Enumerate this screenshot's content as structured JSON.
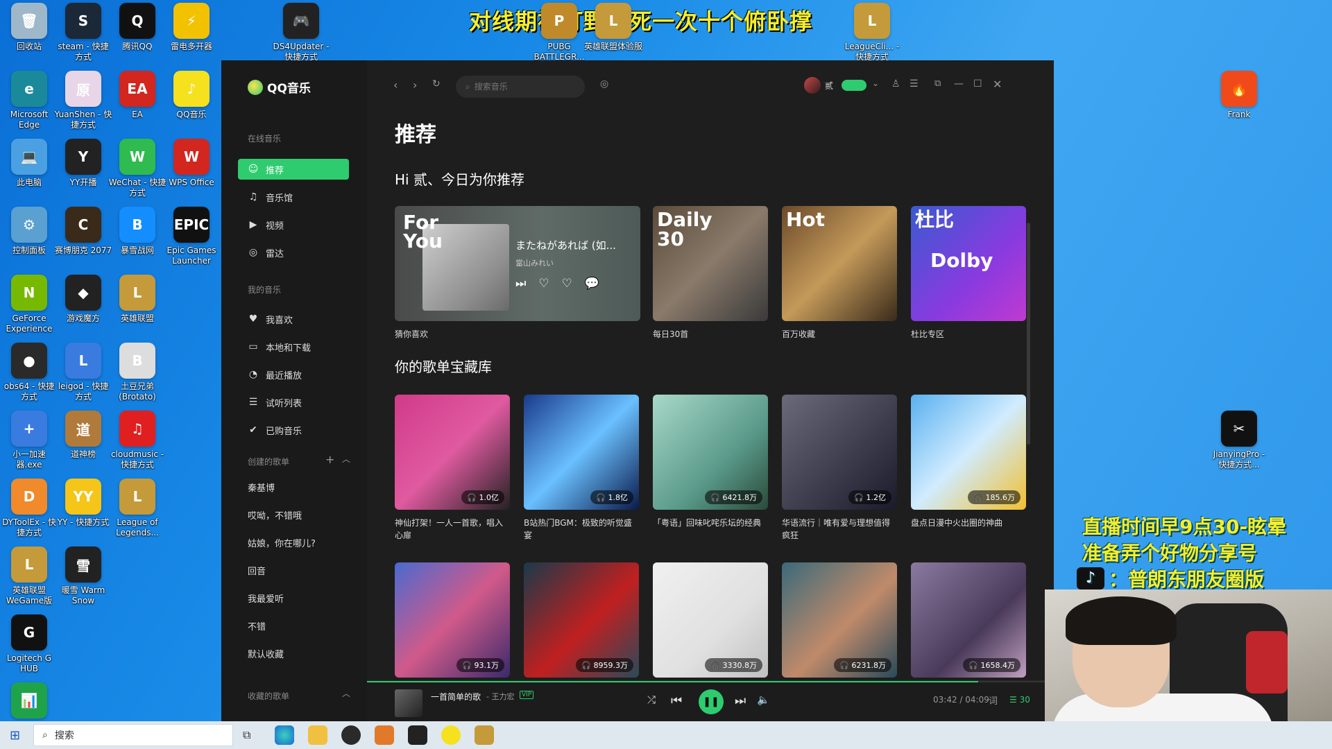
{
  "overlay": {
    "title": "对线期被打野抓死一次十个俯卧撑",
    "right_line1": "直播时间早9点30-眩晕",
    "right_line2": "准备弄个好物分享号",
    "right_line3": "：普朗东朋友圈版"
  },
  "desktop_icons": [
    {
      "label": "回收站",
      "color": "#9fb8c9",
      "glyph": "🗑"
    },
    {
      "label": "steam - 快捷方式",
      "color": "#1b2838",
      "glyph": "S"
    },
    {
      "label": "腾讯QQ",
      "color": "#111",
      "glyph": "Q"
    },
    {
      "label": "雷电多开器",
      "color": "#f2c200",
      "glyph": "⚡"
    },
    {
      "label": "DS4Updater - 快捷方式",
      "color": "#222",
      "glyph": "🎮"
    },
    {
      "label": "PUBG BATTLEGR...",
      "color": "#c08a2a",
      "glyph": "P"
    },
    {
      "label": "英雄联盟体验服",
      "color": "#c49a3a",
      "glyph": "L"
    },
    {
      "label": "LeagueCli... - 快捷方式",
      "color": "#c49a3a",
      "glyph": "L"
    },
    {
      "label": "Microsoft Edge",
      "color": "#1a8a9a",
      "glyph": "e"
    },
    {
      "label": "YuanShen - 快捷方式",
      "color": "#e8d6e8",
      "glyph": "原"
    },
    {
      "label": "EA",
      "color": "#d3261f",
      "glyph": "EA"
    },
    {
      "label": "QQ音乐",
      "color": "#f6e11e",
      "glyph": "♪"
    },
    {
      "label": "此电脑",
      "color": "#4aa0e0",
      "glyph": "💻"
    },
    {
      "label": "YY开播",
      "color": "#222",
      "glyph": "Y"
    },
    {
      "label": "WeChat - 快捷方式",
      "color": "#2fbb4f",
      "glyph": "W"
    },
    {
      "label": "WPS Office",
      "color": "#d3261f",
      "glyph": "W"
    },
    {
      "label": "控制面板",
      "color": "#5aa0d0",
      "glyph": "⚙"
    },
    {
      "label": "赛博朋克 2077",
      "color": "#3a2a1a",
      "glyph": "C"
    },
    {
      "label": "暴雪战网",
      "color": "#148eff",
      "glyph": "B"
    },
    {
      "label": "Epic Games Launcher",
      "color": "#111",
      "glyph": "EPIC"
    },
    {
      "label": "GeForce Experience",
      "color": "#76b900",
      "glyph": "N"
    },
    {
      "label": "游戏魔方",
      "color": "#222",
      "glyph": "◆"
    },
    {
      "label": "英雄联盟",
      "color": "#c49a3a",
      "glyph": "L"
    },
    {
      "label": "obs64 - 快捷方式",
      "color": "#2a2a2a",
      "glyph": "●"
    },
    {
      "label": "leigod - 快捷方式",
      "color": "#3a7be0",
      "glyph": "L"
    },
    {
      "label": "土豆兄弟 (Brotato)",
      "color": "#ddd",
      "glyph": "B"
    },
    {
      "label": "小一加速器.exe",
      "color": "#3a7be0",
      "glyph": "+"
    },
    {
      "label": "道神榜",
      "color": "#b07a3a",
      "glyph": "道"
    },
    {
      "label": "cloudmusic - 快捷方式",
      "color": "#e02020",
      "glyph": "♫"
    },
    {
      "label": "DYToolEx - 快捷方式",
      "color": "#f08a2a",
      "glyph": "D"
    },
    {
      "label": "YY - 快捷方式",
      "color": "#f5c518",
      "glyph": "YY"
    },
    {
      "label": "League of Legends...",
      "color": "#c49a3a",
      "glyph": "L"
    },
    {
      "label": "英雄联盟 WeGame版",
      "color": "#c49a3a",
      "glyph": "L"
    },
    {
      "label": "暖雪 Warm Snow",
      "color": "#222",
      "glyph": "雪"
    },
    {
      "label": "Logitech G HUB",
      "color": "#111",
      "glyph": "G"
    },
    {
      "label": "",
      "color": "#1fa34a",
      "glyph": "📊"
    },
    {
      "label": "Frank",
      "color": "#f04a1a",
      "glyph": "🔥"
    },
    {
      "label": "JianyingPro - 快捷方式...",
      "color": "#111",
      "glyph": "✂"
    }
  ],
  "app": {
    "logo": "QQ音乐",
    "sidebar": {
      "online_title": "在线音乐",
      "online": [
        {
          "label": "推荐",
          "icon": "☺"
        },
        {
          "label": "音乐馆",
          "icon": "♫"
        },
        {
          "label": "视频",
          "icon": "▶"
        },
        {
          "label": "雷达",
          "icon": "◎"
        }
      ],
      "my_title": "我的音乐",
      "my": [
        {
          "label": "我喜欢",
          "icon": "♥"
        },
        {
          "label": "本地和下载",
          "icon": "▭"
        },
        {
          "label": "最近播放",
          "icon": "◔"
        },
        {
          "label": "试听列表",
          "icon": "☰"
        },
        {
          "label": "已购音乐",
          "icon": "✔"
        }
      ],
      "created_title": "创建的歌单",
      "created": [
        "秦基博",
        "哎呦，不错哦",
        "姑娘，你在哪儿?",
        "回音",
        "我最爱听",
        "不错",
        "默认收藏"
      ],
      "collected_title": "收藏的歌单"
    },
    "topbar": {
      "search_placeholder": "搜索音乐",
      "user": "贰"
    },
    "main": {
      "title": "推荐",
      "greeting": "Hi 贰、今日为你推荐",
      "foryou": {
        "label_line1": "For",
        "label_line2": "You",
        "song": "またねがあれば (如...",
        "artist": "當山みれい",
        "caption": "猜你喜欢"
      },
      "rec_cards": [
        {
          "badge": "Daily 30",
          "caption": "每日30首",
          "bg": "linear-gradient(135deg,#5a4a3a,#8a7a6a 50%,#3a3a3a)"
        },
        {
          "badge": "Hot",
          "caption": "百万收藏",
          "bg": "linear-gradient(135deg,#6b4a2a,#c49a5a 50%,#3a2a1a)"
        },
        {
          "badge": "杜比",
          "caption": "杜比专区",
          "bg": "linear-gradient(135deg,#3a5ad0,#8a3ae0 60%,#c03ad0)",
          "extra": "Dolby"
        }
      ],
      "section2": "你的歌单宝藏库",
      "playlists": [
        {
          "plays": "1.0亿",
          "title": "神仙打架！一人一首歌，唱入心扉",
          "bg": "linear-gradient(135deg,#d03a8a,#e05aa0 50%,#222)"
        },
        {
          "plays": "1.8亿",
          "title": "B站热门BGM：极致的听觉盛宴",
          "bg": "linear-gradient(135deg,#1a3a8a,#6ac0ff 50%,#0a1a4a)"
        },
        {
          "plays": "6421.8万",
          "title": "「粤语」回味叱咤乐坛的经典",
          "bg": "linear-gradient(135deg,#a8d8c8,#5a9a8a 60%,#2a4a3a)"
        },
        {
          "plays": "1.2亿",
          "title": "华语流行｜唯有爱与理想值得疯狂",
          "bg": "linear-gradient(135deg,#6a6a7a,#3a3a4a 60%,#1a1a2a)"
        },
        {
          "plays": "185.6万",
          "title": "盘点日漫中火出圈的神曲",
          "bg": "linear-gradient(135deg,#5ab0f0,#d0ecff 50%,#f0c030)"
        },
        {
          "plays": "93.1万",
          "title": "",
          "bg": "linear-gradient(135deg,#4a6ad0,#d05a8a 50%,#3a2a6a)"
        },
        {
          "plays": "8959.3万",
          "title": "",
          "bg": "linear-gradient(135deg,#1a3a4a,#c02020 55%,#2a4a5a)"
        },
        {
          "plays": "3330.8万",
          "title": "",
          "bg": "linear-gradient(135deg,#f0f0f0,#e0e0e0 60%,#c0c0c0)"
        },
        {
          "plays": "6231.8万",
          "title": "",
          "bg": "linear-gradient(135deg,#3a6a7a,#c08a6a 55%,#2a4a5a)"
        },
        {
          "plays": "1658.4万",
          "title": "",
          "bg": "linear-gradient(135deg,#8a7aa0,#4a3a5a 60%,#c0a0c0)"
        }
      ]
    },
    "player": {
      "song": "一首简单的歌",
      "artist": "- 王力宏",
      "vip": "VIP",
      "time": "03:42 / 04:09",
      "queue": "30",
      "progress": 0.89
    }
  },
  "taskbar": {
    "search": "搜索"
  }
}
